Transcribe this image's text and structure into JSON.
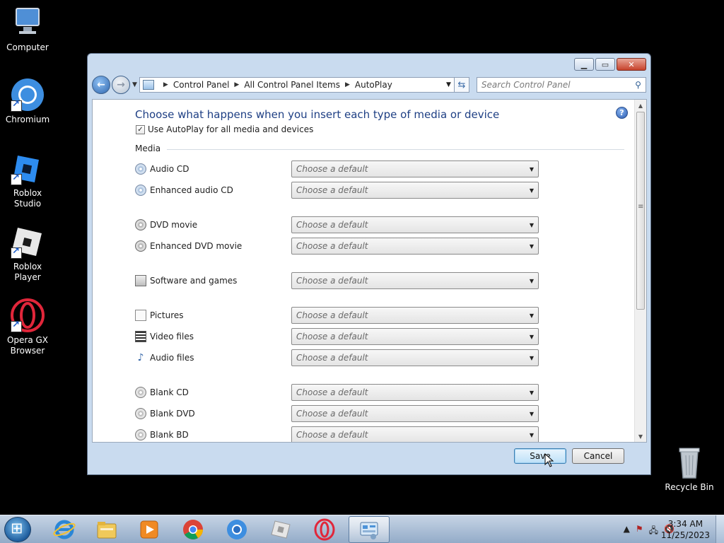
{
  "desktop": {
    "icons": [
      {
        "label": "Computer",
        "icon": "computer-icon"
      },
      {
        "label": "Chromium",
        "icon": "chromium-icon"
      },
      {
        "label": "Roblox Studio",
        "icon": "roblox-studio-icon"
      },
      {
        "label": "Roblox Player",
        "icon": "roblox-player-icon"
      },
      {
        "label": "Opera GX Browser",
        "icon": "opera-gx-icon"
      },
      {
        "label": "Recycle Bin",
        "icon": "recycle-bin-icon"
      }
    ]
  },
  "window": {
    "breadcrumb": [
      "Control Panel",
      "All Control Panel Items",
      "AutoPlay"
    ],
    "search_placeholder": "Search Control Panel",
    "heading": "Choose what happens when you insert each type of media or device",
    "autoplay_checkbox": {
      "label": "Use AutoPlay for all media and devices",
      "checked": true
    },
    "section_label": "Media",
    "combo_default": "Choose a default",
    "media_items": [
      {
        "label": "Audio CD",
        "icon": "audio-cd-icon",
        "value": "Choose a default"
      },
      {
        "label": "Enhanced audio CD",
        "icon": "enhanced-audio-cd-icon",
        "value": "Choose a default"
      },
      {
        "label": "DVD movie",
        "icon": "dvd-movie-icon",
        "value": "Choose a default"
      },
      {
        "label": "Enhanced DVD movie",
        "icon": "enhanced-dvd-movie-icon",
        "value": "Choose a default"
      },
      {
        "label": "Software and games",
        "icon": "software-games-icon",
        "value": "Choose a default"
      },
      {
        "label": "Pictures",
        "icon": "pictures-icon",
        "value": "Choose a default"
      },
      {
        "label": "Video files",
        "icon": "video-files-icon",
        "value": "Choose a default"
      },
      {
        "label": "Audio files",
        "icon": "audio-files-icon",
        "value": "Choose a default"
      },
      {
        "label": "Blank CD",
        "icon": "blank-cd-icon",
        "value": "Choose a default"
      },
      {
        "label": "Blank DVD",
        "icon": "blank-dvd-icon",
        "value": "Choose a default"
      },
      {
        "label": "Blank BD",
        "icon": "blank-bd-icon",
        "value": "Choose a default"
      }
    ],
    "save_label": "Save",
    "cancel_label": "Cancel"
  },
  "taskbar": {
    "apps": [
      "internet-explorer-icon",
      "file-explorer-icon",
      "media-player-icon",
      "chrome-icon",
      "chromium-icon",
      "roblox-icon",
      "opera-gx-icon",
      "control-panel-icon"
    ],
    "time": "3:34 AM",
    "date": "11/25/2023"
  },
  "colors": {
    "heading": "#1e3f84",
    "accent": "#3c7fb1"
  }
}
